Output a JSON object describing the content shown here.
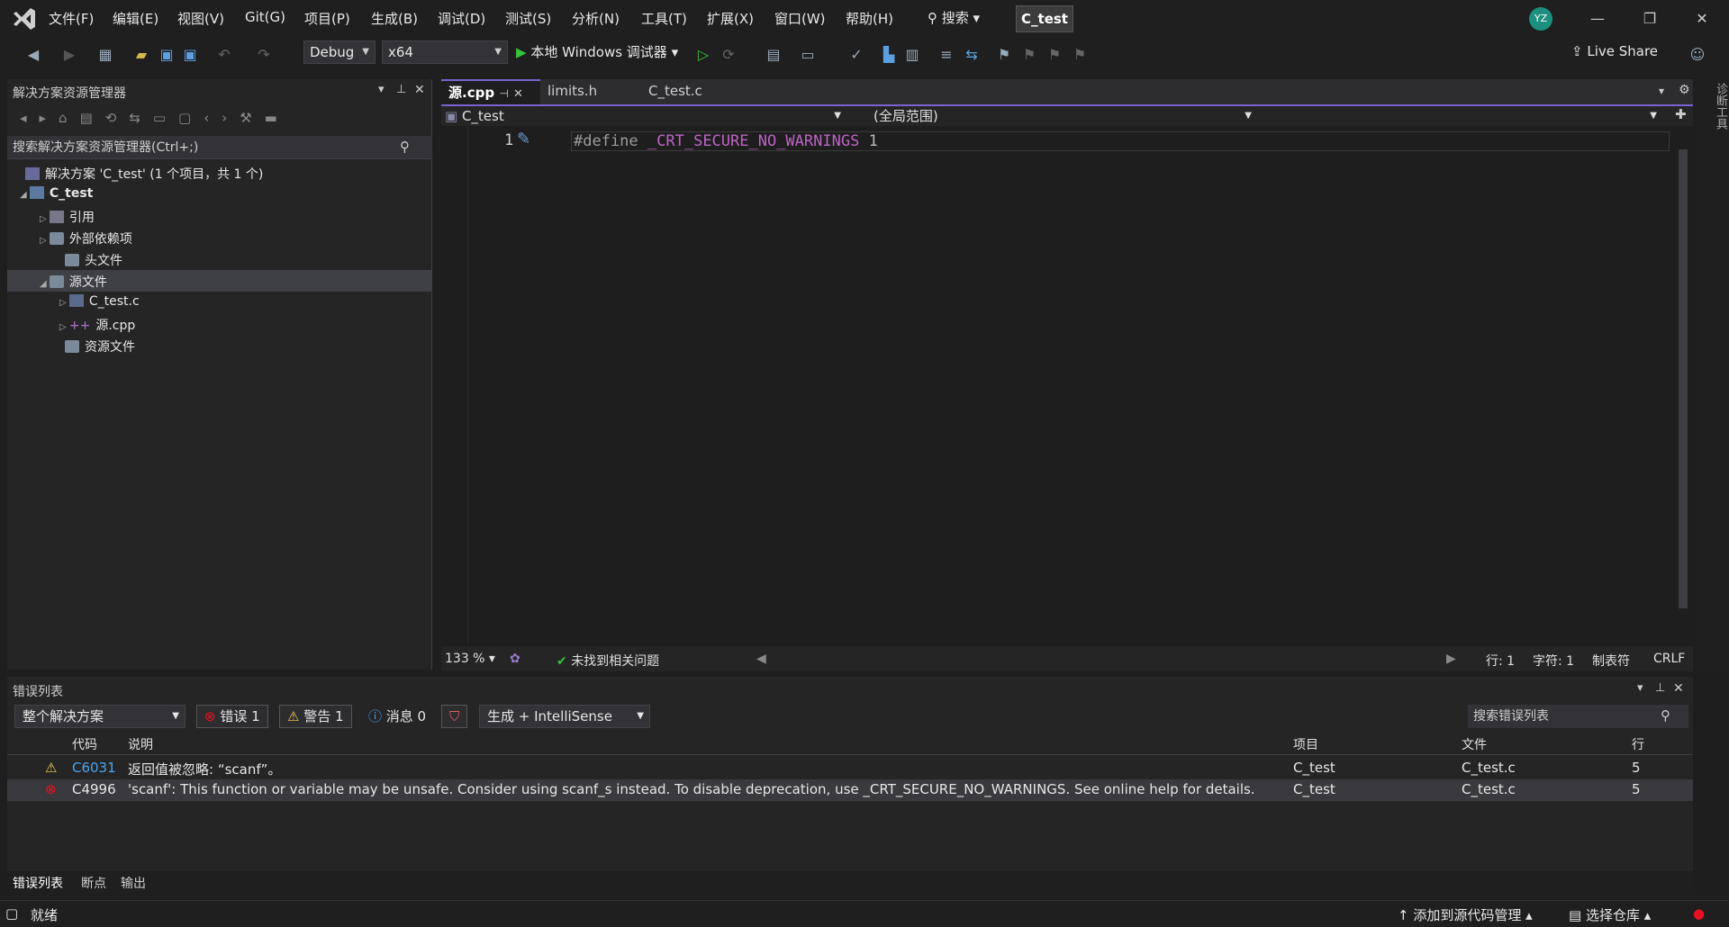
{
  "menubar": {
    "items": [
      "文件(F)",
      "编辑(E)",
      "视图(V)",
      "Git(G)",
      "项目(P)",
      "生成(B)",
      "调试(D)",
      "测试(S)",
      "分析(N)",
      "工具(T)",
      "扩展(X)",
      "窗口(W)",
      "帮助(H)"
    ],
    "search_label": "搜索",
    "solution_name": "C_test",
    "avatar": "YZ"
  },
  "toolbar": {
    "config": "Debug",
    "platform": "x64",
    "debugger": "本地 Windows 调试器",
    "live_share": "Live Share"
  },
  "solution_explorer": {
    "title": "解决方案资源管理器",
    "search_placeholder": "搜索解决方案资源管理器(Ctrl+;)",
    "solution": "解决方案 'C_test' (1 个项目，共 1 个)",
    "project": "C_test",
    "items": [
      "引用",
      "外部依赖项",
      "头文件",
      "源文件",
      "C_test.c",
      "源.cpp",
      "资源文件"
    ]
  },
  "editor": {
    "tabs": [
      "源.cpp",
      "limits.h",
      "C_test.c"
    ],
    "nav_project": "C_test",
    "nav_scope": "(全局范围)",
    "line_number": "1",
    "code_keyword": "#define",
    "code_macro": "_CRT_SECURE_NO_WARNINGS",
    "code_value": "1",
    "zoom": "133 %",
    "issues": "未找到相关问题",
    "line": "行: 1",
    "char": "字符: 1",
    "tabs_mode": "制表符",
    "eol": "CRLF"
  },
  "error_list": {
    "title": "错误列表",
    "scope": "整个解决方案",
    "errors": "错误 1",
    "warnings": "警告 1",
    "messages": "消息 0",
    "source": "生成 + IntelliSense",
    "search_placeholder": "搜索错误列表",
    "columns": [
      "代码",
      "说明",
      "项目",
      "文件",
      "行"
    ],
    "rows": [
      {
        "code": "C6031",
        "desc": "返回值被忽略: “scanf”。",
        "project": "C_test",
        "file": "C_test.c",
        "line": "5"
      },
      {
        "code": "C4996",
        "desc": "'scanf': This function or variable may be unsafe. Consider using scanf_s instead. To disable deprecation, use _CRT_SECURE_NO_WARNINGS. See online help for details.",
        "project": "C_test",
        "file": "C_test.c",
        "line": "5"
      }
    ]
  },
  "bottom_tabs": [
    "错误列表",
    "断点",
    "输出"
  ],
  "statusbar": {
    "ready": "就绪",
    "source_control": "添加到源代码管理",
    "repo": "选择仓库"
  },
  "right_rail": "诊断工具",
  "colors": {
    "accent": "#7a62d0",
    "link": "#4aa3f0",
    "error": "#e81123",
    "warning": "#f2c94c"
  }
}
